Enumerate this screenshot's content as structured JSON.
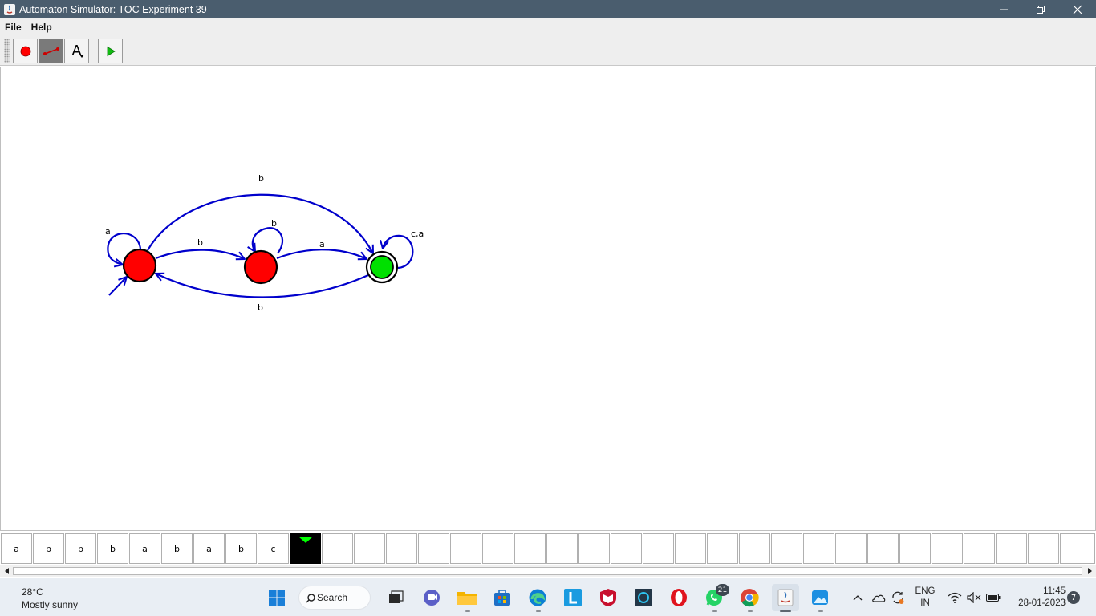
{
  "window": {
    "title": "Automaton Simulator: TOC Experiment 39"
  },
  "menu": [
    {
      "label": "File"
    },
    {
      "label": "Help"
    }
  ],
  "toolbar": {
    "text_tool_glyph": "A"
  },
  "automaton": {
    "states": [
      {
        "id": "q0",
        "initial": true,
        "accepting": false,
        "color": "#ff0000"
      },
      {
        "id": "q1",
        "initial": false,
        "accepting": false,
        "color": "#ff0000"
      },
      {
        "id": "q2",
        "initial": false,
        "accepting": true,
        "color": "#00e000"
      }
    ],
    "transitions": [
      {
        "from": "q0",
        "to": "q0",
        "label": "a"
      },
      {
        "from": "q0",
        "to": "q1",
        "label": "b"
      },
      {
        "from": "q0",
        "to": "q2",
        "label": "b"
      },
      {
        "from": "q1",
        "to": "q1",
        "label": "b"
      },
      {
        "from": "q1",
        "to": "q2",
        "label": "a"
      },
      {
        "from": "q2",
        "to": "q2",
        "label": "c,a"
      },
      {
        "from": "q2",
        "to": "q0",
        "label": "b"
      }
    ],
    "edge_color": "#0000cc"
  },
  "tape": {
    "cells": [
      "a",
      "b",
      "b",
      "b",
      "a",
      "b",
      "a",
      "b",
      "c"
    ],
    "head_index": 9,
    "head_color": "#00ff00"
  },
  "taskbar": {
    "weather_temp": "28°C",
    "weather_desc": "Mostly sunny",
    "search_label": "Search",
    "whatsapp_badge": "21",
    "lang_line1": "ENG",
    "lang_line2": "IN",
    "time": "11:45",
    "date": "28-01-2023",
    "notification_count": "7"
  }
}
